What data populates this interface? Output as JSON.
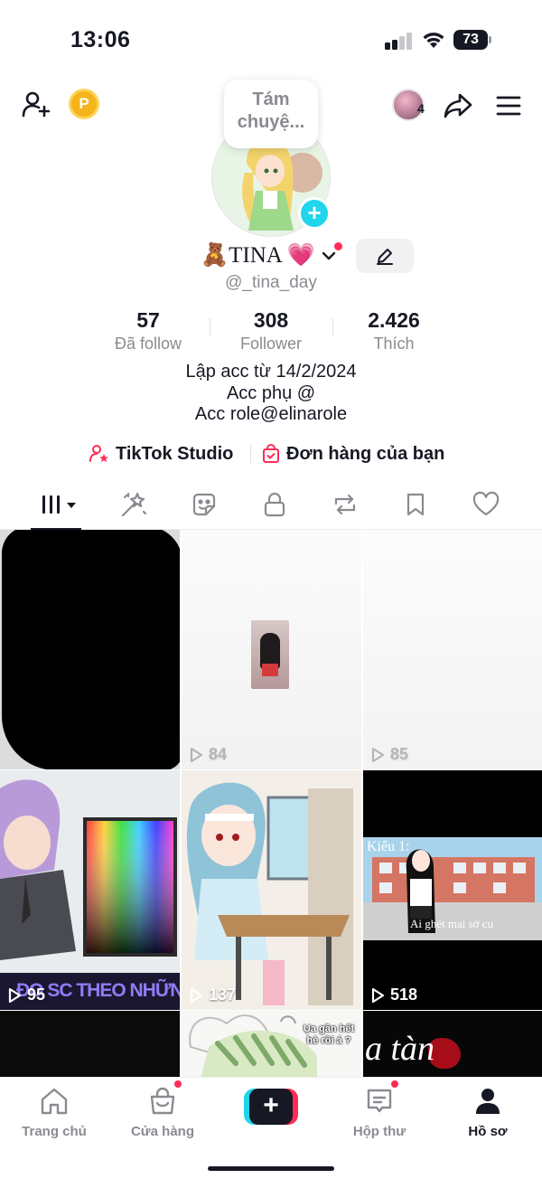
{
  "status_bar": {
    "time": "13:06",
    "battery": "73"
  },
  "header": {
    "coin_label": "P",
    "mini_avatar_badge": "4"
  },
  "profile": {
    "note": "Tám chuyệ...",
    "display_name": "🧸TINA 💗",
    "username": "@_tina_day",
    "stats": [
      {
        "value": "57",
        "label": "Đã follow"
      },
      {
        "value": "308",
        "label": "Follower"
      },
      {
        "value": "2.426",
        "label": "Thích"
      }
    ],
    "bio": [
      "Lập acc từ 14/2/2024",
      "Acc phụ @",
      "Acc role@elinarole"
    ],
    "links": {
      "studio": "TikTok Studio",
      "orders": "Đơn hàng của bạn"
    }
  },
  "tabs": [
    "videos-grid",
    "reposts-sparkle",
    "stickers",
    "private-lock",
    "repost",
    "bookmark",
    "liked-heart"
  ],
  "grid": {
    "items": [
      {
        "views": ""
      },
      {
        "views": "84"
      },
      {
        "views": "85"
      },
      {
        "views": "95",
        "caption": "ĐO SC THEO NHỮNG M"
      },
      {
        "views": "137"
      },
      {
        "views": "518",
        "caption_top": "Kiểu 1:",
        "caption_bottom": "Ai ghét mai sờ cu"
      },
      {
        "views": ""
      },
      {
        "views": "",
        "caption": "Ụa gần hết hè rồi á ?"
      },
      {
        "views": "",
        "caption": "a tàn"
      }
    ]
  },
  "bottom_nav": {
    "items": [
      {
        "label": "Trang chủ"
      },
      {
        "label": "Cửa hàng"
      },
      {
        "label": "Hộp thư"
      },
      {
        "label": "Hồ sơ"
      }
    ]
  },
  "colors": {
    "accent_red": "#fe2c55",
    "accent_cyan": "#20d5ec",
    "text_primary": "#161823",
    "text_secondary": "#8a8b91"
  }
}
